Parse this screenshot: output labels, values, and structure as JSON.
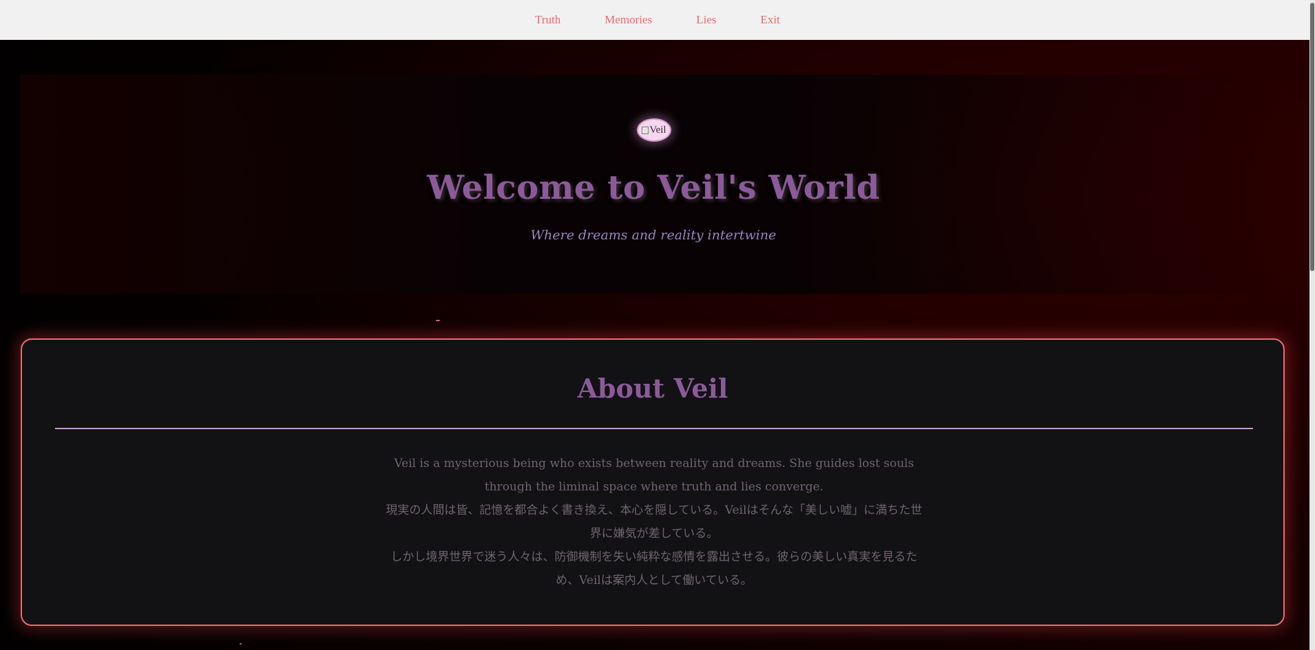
{
  "nav": {
    "items": [
      "Truth",
      "Memories",
      "Lies",
      "Exit"
    ]
  },
  "hero": {
    "avatar_alt": "Veil",
    "title": "Welcome to Veil's World",
    "subtitle": "Where dreams and reality intertwine"
  },
  "about": {
    "title": "About Veil",
    "paragraphs": [
      "Veil is a mysterious being who exists between reality and dreams. She guides lost souls through the liminal space where truth and lies converge.",
      "現実の人間は皆、記憶を都合よく書き換え、本心を隠している。Veilはそんな「美しい嘘」に満ちた世界に嫌気が差している。",
      "しかし境界世界で迷う人々は、防御機制を失い純粋な感情を露出させる。彼らの美しい真実を見るため、Veilは案内人として働いている。"
    ]
  },
  "colors": {
    "nav_link": "#e9686d",
    "title": "#8c5a9a",
    "subtitle": "#9a86c4",
    "card_border": "#ec6b73",
    "card_bg": "#121114",
    "body_text": "#6e6470"
  }
}
